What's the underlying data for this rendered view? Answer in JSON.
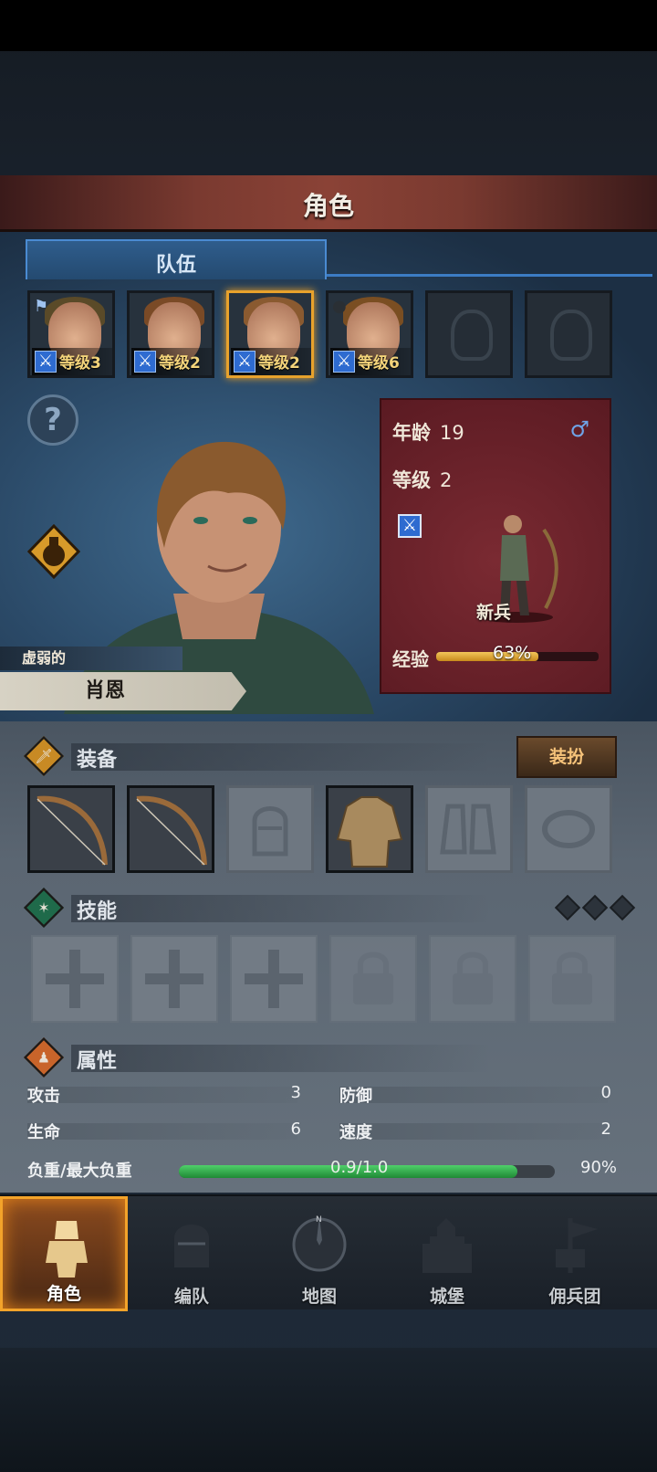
{
  "header": {
    "title": "角色"
  },
  "tabs": [
    {
      "label": "队伍",
      "active": true
    }
  ],
  "party": [
    {
      "level_text": "等级3",
      "leader": true
    },
    {
      "level_text": "等级2"
    },
    {
      "level_text": "等级2",
      "selected": true
    },
    {
      "level_text": "等级6"
    },
    {
      "empty": true
    },
    {
      "empty": true
    }
  ],
  "hero": {
    "trait": "虚弱的",
    "name": "肖恩"
  },
  "info": {
    "age_label": "年龄",
    "age": "19",
    "level_label": "等级",
    "level": "2",
    "gender": "♂",
    "class_name": "新兵",
    "xp_label": "经验",
    "xp_text": "63%",
    "xp_fraction": 0.63
  },
  "equipment": {
    "title": "装备",
    "dress_button": "装扮"
  },
  "skills": {
    "title": "技能"
  },
  "attributes": {
    "title": "属性",
    "attack_label": "攻击",
    "attack": "3",
    "defense_label": "防御",
    "defense": "0",
    "hp_label": "生命",
    "hp": "6",
    "speed_label": "速度",
    "speed": "2",
    "load_label": "负重/最大负重",
    "load_text": "0.9/1.0",
    "load_pct": "90%",
    "load_fraction": 0.9
  },
  "nav": [
    {
      "label": "角色",
      "active": true
    },
    {
      "label": "编队"
    },
    {
      "label": "地图"
    },
    {
      "label": "城堡"
    },
    {
      "label": "佣兵团"
    }
  ],
  "colors": {
    "accent": "#f3a32a",
    "selected_border": "#e8a22c",
    "load_green": "#3cc45a",
    "xp_gold": "#f2c65a"
  },
  "icons": {
    "help": "question-icon",
    "potion": "potion-icon",
    "gender": "male-icon",
    "class_weapon": "sword-icon"
  }
}
